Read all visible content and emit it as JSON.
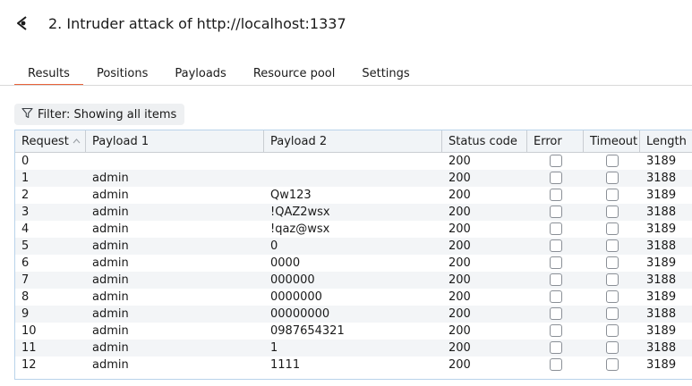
{
  "window": {
    "title": "2. Intruder attack of http://localhost:1337",
    "app_icon": "burp-intruder-icon"
  },
  "tabs": [
    {
      "label": "Results",
      "active": true
    },
    {
      "label": "Positions",
      "active": false
    },
    {
      "label": "Payloads",
      "active": false
    },
    {
      "label": "Resource pool",
      "active": false
    },
    {
      "label": "Settings",
      "active": false
    }
  ],
  "filter": {
    "icon": "filter-icon",
    "label": "Filter: Showing all items"
  },
  "table": {
    "columns": [
      "Request",
      "Payload 1",
      "Payload 2",
      "Status code",
      "Error",
      "Timeout",
      "Length"
    ],
    "sort": {
      "column": "Request",
      "direction": "ascending"
    },
    "rows": [
      {
        "request": "0",
        "payload1": "",
        "payload2": "",
        "status": "200",
        "error": false,
        "timeout": false,
        "length": "3189"
      },
      {
        "request": "1",
        "payload1": "admin",
        "payload2": "",
        "status": "200",
        "error": false,
        "timeout": false,
        "length": "3188"
      },
      {
        "request": "2",
        "payload1": "admin",
        "payload2": "Qw123",
        "status": "200",
        "error": false,
        "timeout": false,
        "length": "3189"
      },
      {
        "request": "3",
        "payload1": "admin",
        "payload2": "!QAZ2wsx",
        "status": "200",
        "error": false,
        "timeout": false,
        "length": "3188"
      },
      {
        "request": "4",
        "payload1": "admin",
        "payload2": "!qaz@wsx",
        "status": "200",
        "error": false,
        "timeout": false,
        "length": "3189"
      },
      {
        "request": "5",
        "payload1": "admin",
        "payload2": "0",
        "status": "200",
        "error": false,
        "timeout": false,
        "length": "3188"
      },
      {
        "request": "6",
        "payload1": "admin",
        "payload2": "0000",
        "status": "200",
        "error": false,
        "timeout": false,
        "length": "3189"
      },
      {
        "request": "7",
        "payload1": "admin",
        "payload2": "000000",
        "status": "200",
        "error": false,
        "timeout": false,
        "length": "3188"
      },
      {
        "request": "8",
        "payload1": "admin",
        "payload2": "0000000",
        "status": "200",
        "error": false,
        "timeout": false,
        "length": "3189"
      },
      {
        "request": "9",
        "payload1": "admin",
        "payload2": "00000000",
        "status": "200",
        "error": false,
        "timeout": false,
        "length": "3188"
      },
      {
        "request": "10",
        "payload1": "admin",
        "payload2": "0987654321",
        "status": "200",
        "error": false,
        "timeout": false,
        "length": "3189"
      },
      {
        "request": "11",
        "payload1": "admin",
        "payload2": "1",
        "status": "200",
        "error": false,
        "timeout": false,
        "length": "3188"
      },
      {
        "request": "12",
        "payload1": "admin",
        "payload2": "1111",
        "status": "200",
        "error": false,
        "timeout": false,
        "length": "3189"
      }
    ]
  },
  "colors": {
    "active_tab_underline": "#e8623a",
    "table_border": "#b9d3ea"
  }
}
